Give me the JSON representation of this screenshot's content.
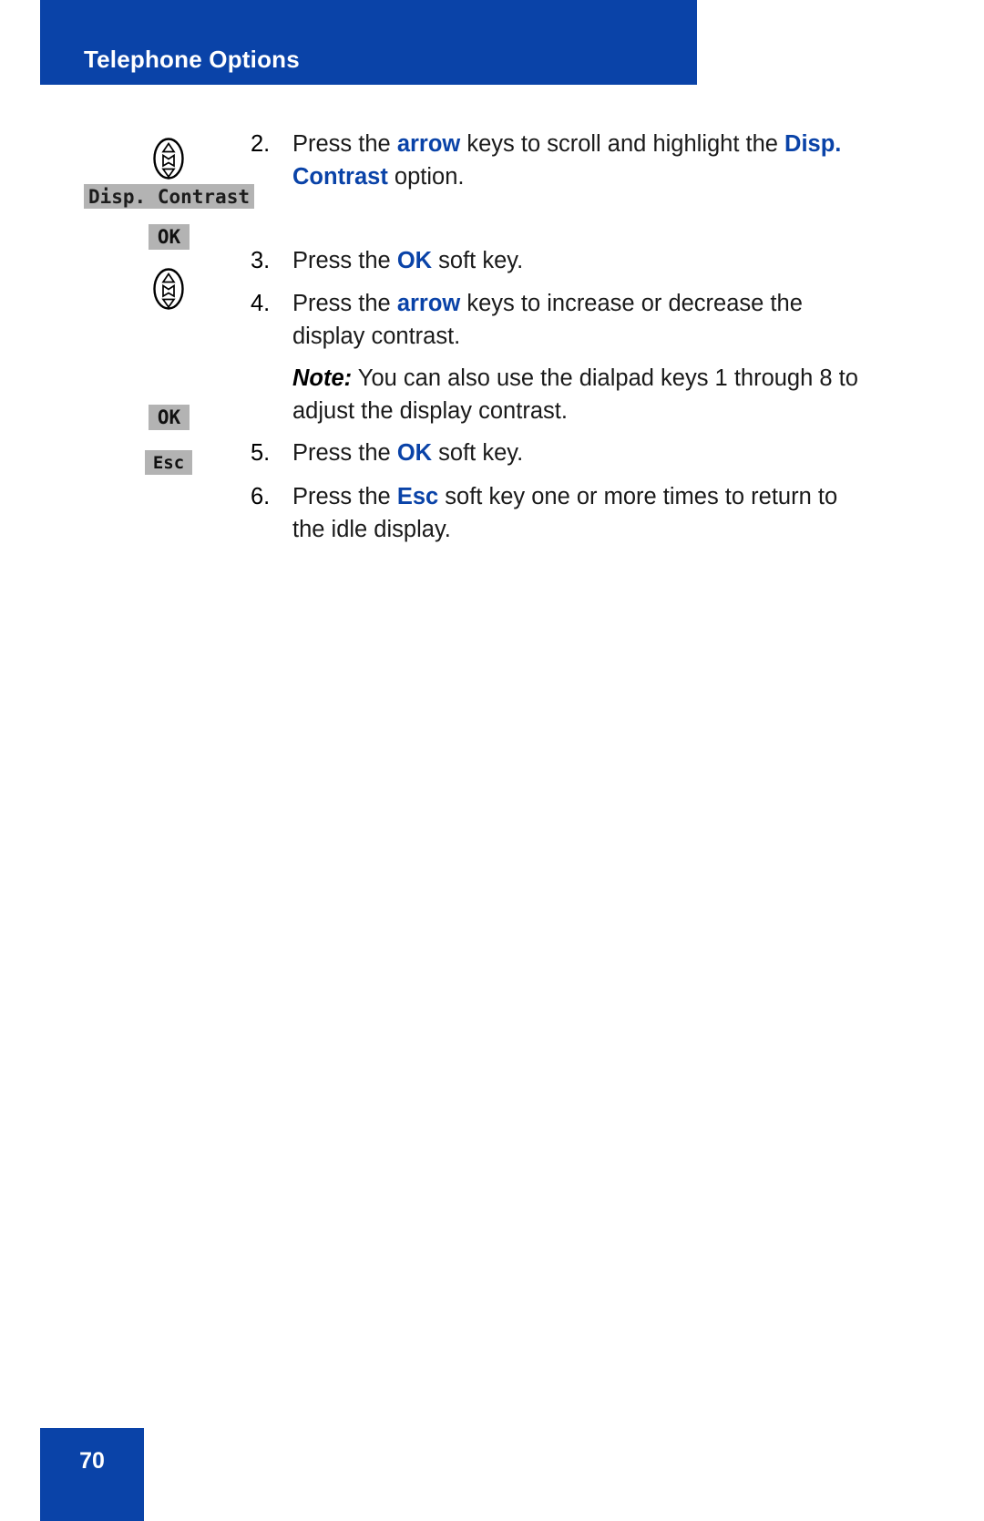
{
  "header": {
    "title": "Telephone Options",
    "bar_color": "#0A43A8"
  },
  "footer": {
    "page_number": "70",
    "bar_color": "#0A43A8"
  },
  "theme": {
    "accent_blue": "#0A43A8",
    "lcd_gray": "#b3b3b3",
    "text_black": "#1a1a1a"
  },
  "steps": [
    {
      "number": "2.",
      "icon": "navigation-arrow-key",
      "lcd_label": "Disp. Contrast",
      "text_parts": [
        {
          "t": "Press the ",
          "style": "plain"
        },
        {
          "t": "arrow",
          "style": "bold-blue"
        },
        {
          "t": " keys to scroll and highlight the ",
          "style": "plain"
        },
        {
          "t": "Disp. Contrast",
          "style": "bold-blue"
        },
        {
          "t": " option.",
          "style": "plain"
        }
      ]
    },
    {
      "number": "3.",
      "icon": "ok-soft-key",
      "key_label": "OK",
      "text_parts": [
        {
          "t": "Press the ",
          "style": "plain"
        },
        {
          "t": "OK",
          "style": "bold-blue"
        },
        {
          "t": " soft key.",
          "style": "plain"
        }
      ]
    },
    {
      "number": "4.",
      "icon": "navigation-arrow-key",
      "text_parts": [
        {
          "t": "Press the ",
          "style": "plain"
        },
        {
          "t": "arrow",
          "style": "bold-blue"
        },
        {
          "t": " keys to increase or decrease the display contrast.",
          "style": "plain"
        }
      ]
    },
    {
      "number": "",
      "icon": "",
      "note_label": "Note:",
      "note_text": " You can also use the dialpad keys 1 through 8 to adjust the display contrast."
    },
    {
      "number": "5.",
      "icon": "ok-soft-key",
      "key_label": "OK",
      "text_parts": [
        {
          "t": "Press the ",
          "style": "plain"
        },
        {
          "t": "OK",
          "style": "bold-blue"
        },
        {
          "t": " soft key.",
          "style": "plain"
        }
      ]
    },
    {
      "number": "6.",
      "icon": "esc-soft-key",
      "key_label": "Esc",
      "text_parts": [
        {
          "t": "Press the ",
          "style": "plain"
        },
        {
          "t": "Esc",
          "style": "bold-blue"
        },
        {
          "t": " soft key one or more times to return to the idle display.",
          "style": "plain"
        }
      ]
    }
  ]
}
